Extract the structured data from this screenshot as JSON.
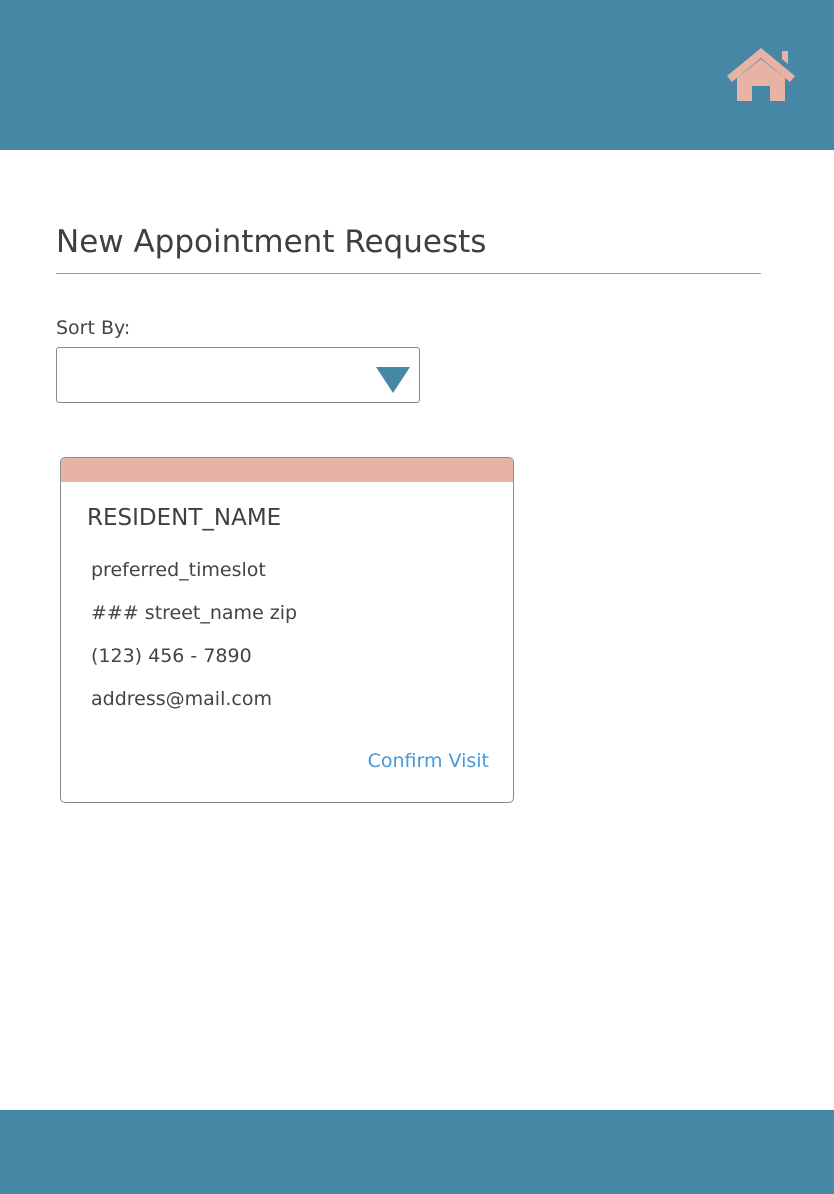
{
  "header": {
    "home_icon": "home-icon",
    "bar_color": "#4687a6",
    "icon_color": "#e8b3a5"
  },
  "main": {
    "title": "New Appointment Requests",
    "sort": {
      "label": "Sort By:",
      "selected_value": ""
    }
  },
  "appointment_card": {
    "accent_color": "#e8b3a5",
    "resident_name": "RESIDENT_NAME",
    "preferred_timeslot": "preferred_timeslot",
    "address": "### street_name zip",
    "phone": "(123) 456 - 7890",
    "email": "address@mail.com",
    "confirm_label": "Confirm Visit"
  }
}
